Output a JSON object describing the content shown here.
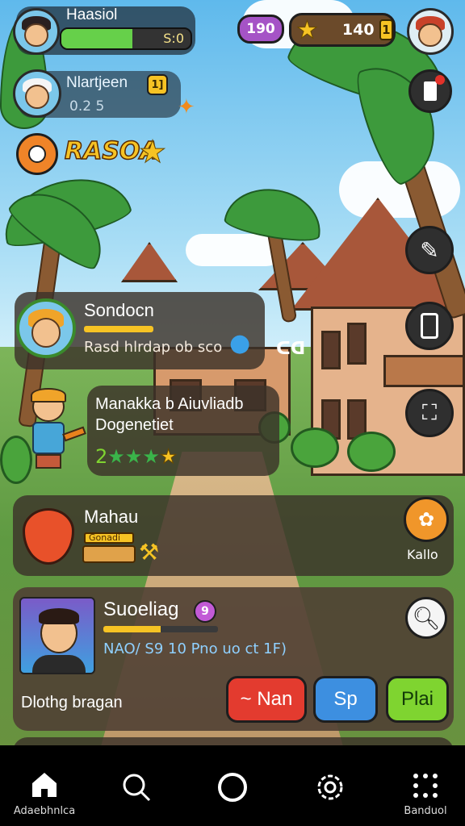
{
  "player": {
    "name": "Haasiol",
    "xp_text": "S:0",
    "xp_progress": 0.55
  },
  "currencies": {
    "gems": "190",
    "stars": "140",
    "star_badge": "1"
  },
  "friend": {
    "name": "Nlartjeen",
    "level": "1]",
    "sub": "0.2 5"
  },
  "event": {
    "title": "RASOA"
  },
  "quest": {
    "title": "Sondocn",
    "desc": "Rasd hlrdap ob sco",
    "extra": "ᑕꓷ"
  },
  "task": {
    "line1": "Manakka b Aiuvliadb",
    "line2": "Dogenetiet",
    "rating": "2"
  },
  "market": {
    "title": "Mahau",
    "sub_tag": "Gonadi",
    "action_label": "Kallo"
  },
  "profile": {
    "title": "Suoeliag",
    "badge": "9",
    "stats": "NAO/ S9 10  Pno uo ct 1F)",
    "footer": "Dlothg bragan",
    "progress": 0.5
  },
  "buttons": {
    "nan": "~ Nan",
    "sp": "Sp",
    "play": "Plai"
  },
  "nav": {
    "home_label": "Adaebhnlca",
    "fourth_label": "",
    "last_label": "Banduol"
  },
  "colors": {
    "gem_pill": "#a553c6",
    "xp_fill": "#66d04a",
    "red_btn": "#e33b2f",
    "blue_btn": "#3d8fe0",
    "green_btn": "#7fd430",
    "gold": "#f6c324"
  }
}
